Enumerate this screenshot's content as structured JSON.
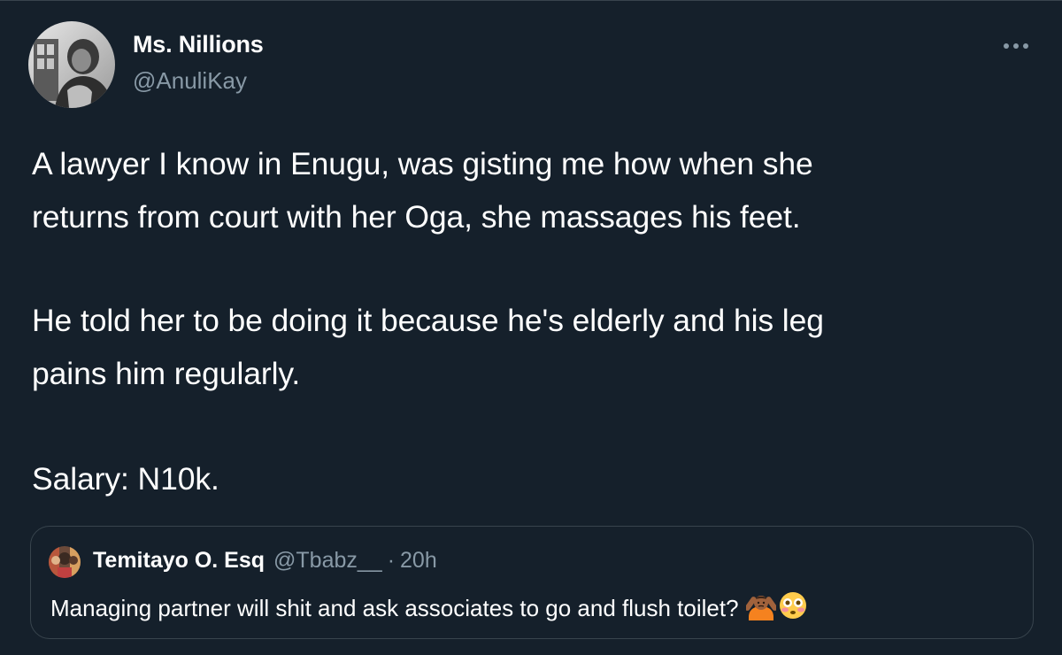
{
  "author": {
    "display_name": "Ms. Nillions",
    "handle": "@AnuliKay",
    "avatar_icon": "profile-photo-grayscale"
  },
  "tweet": {
    "lines": [
      "A lawyer I know in Enugu, was gisting me how when she",
      "returns from court with her Oga, she massages his feet.",
      "He told her to be doing it because he's elderly and his leg",
      "pains him regularly.",
      "Salary: N10k."
    ]
  },
  "quoted": {
    "display_name": "Temitayo O. Esq",
    "handle": "@Tbabz__",
    "separator": "·",
    "time": "20h",
    "text": "Managing partner will shit and ask associates to go and flush toilet?",
    "emojis": [
      "person-gesturing-no-emoji",
      "flushed-face-emoji"
    ]
  },
  "menu": {
    "icon": "more-options-icon"
  },
  "colors": {
    "background": "#15202b",
    "border": "#38444d",
    "secondary_text": "#8899a6",
    "primary_text": "#ffffff"
  }
}
